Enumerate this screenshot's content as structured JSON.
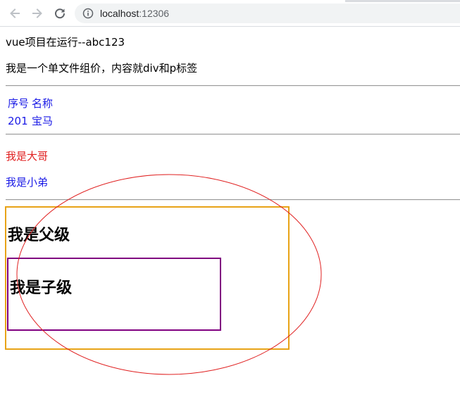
{
  "browser": {
    "url_host": "localhost",
    "url_port": ":12306"
  },
  "page": {
    "status_line": "vue项目在运行--abc123",
    "description_line": "我是一个单文件组价，内容就div和p标签",
    "table": {
      "header": [
        "序号",
        "名称"
      ],
      "rows": [
        [
          "201",
          "宝马"
        ]
      ]
    },
    "elder_text": "我是大哥",
    "younger_text": "我是小弟",
    "parent_title": "我是父级",
    "child_title": "我是子级"
  },
  "colors": {
    "text_blue": "#1a1ae6",
    "text_red": "#e02020",
    "parent_border": "#e8a317",
    "child_border": "#800080",
    "ellipse_stroke": "#e02020"
  }
}
